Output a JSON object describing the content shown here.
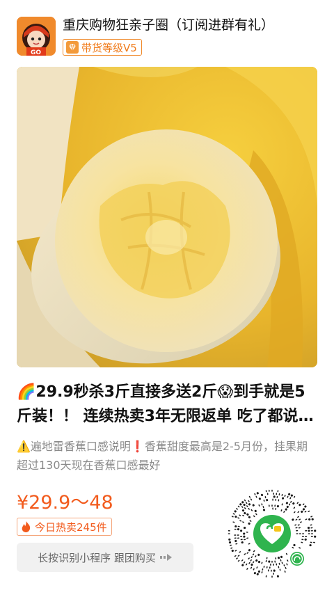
{
  "header": {
    "shop_name": "重庆购物狂亲子圈（订阅进群有礼）",
    "avatar_text": "GO",
    "level_label": "带货等级V5",
    "level_icon": "diamond-icon"
  },
  "product": {
    "image_alt": "banana",
    "title": "🌈29.9秒杀3斤直接多送2斤😱到手就是5斤装！！ 连续热卖3年无限返单 吃了都说好吃！",
    "description": "⚠️遍地雷香蕉口感说明❗香蕉甜度最高是2-5月份，挂果期超过130天现在香蕉口感最好",
    "price": "¥29.9～48",
    "hot_sale": "今日热卖245件",
    "hot_icon": "flame-icon"
  },
  "cta": {
    "label": "长按识别小程序 跟团购买",
    "icon": "arrow-right-icon"
  },
  "qr": {
    "icon": "mini-program-code"
  },
  "colors": {
    "accent": "#f25b1d",
    "badge_orange": "#f07a18",
    "qr_green": "#2fb44e"
  }
}
